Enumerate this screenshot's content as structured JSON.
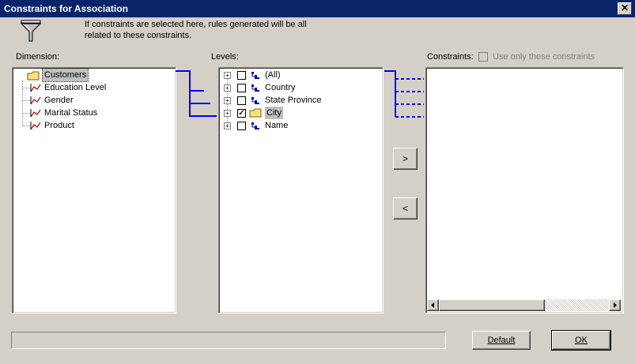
{
  "window": {
    "title": "Constraints for Association",
    "close_glyph": "✕"
  },
  "info": {
    "line1": "If constraints are selected here, rules generated will be all",
    "line2": "related to these constraints.",
    "icon": "filter-funnel-icon"
  },
  "dimension": {
    "label": "Dimension:",
    "root": "Customers",
    "items": [
      "Education Level",
      "Gender",
      "Marital Status",
      "Product"
    ]
  },
  "levels": {
    "label": "Levels:",
    "items": [
      {
        "label": "(All)",
        "checked": false,
        "icon": "level-icon"
      },
      {
        "label": "Country",
        "checked": false,
        "icon": "level-icon"
      },
      {
        "label": "State Province",
        "checked": false,
        "icon": "level-icon"
      },
      {
        "label": "City",
        "checked": true,
        "icon": "folder-icon"
      },
      {
        "label": "Name",
        "checked": false,
        "icon": "level-icon"
      }
    ],
    "check_glyph": "✓"
  },
  "constraints": {
    "label": "Constraints:",
    "checkbox_label": "Use only these constraints",
    "checkbox_checked": false
  },
  "buttons": {
    "add": ">",
    "remove": "<",
    "default": "Default",
    "ok": "OK"
  },
  "colors": {
    "titlebar": "#0a246a",
    "connector": "#0000ff",
    "face": "#d4d0c8"
  }
}
